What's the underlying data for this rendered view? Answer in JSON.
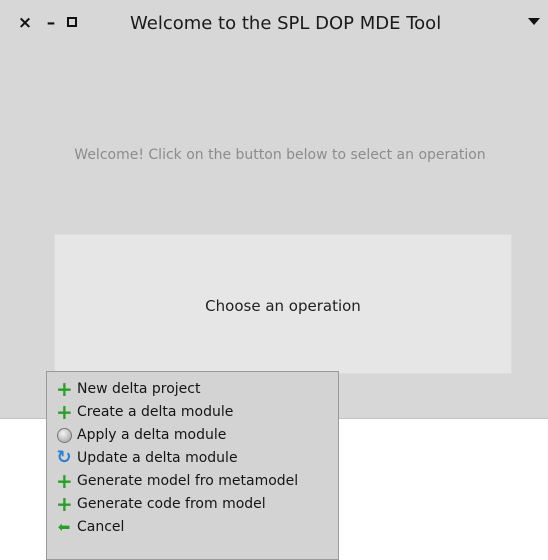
{
  "window": {
    "title": "Welcome to the SPL DOP MDE Tool",
    "close_glyph": "×",
    "minimize_glyph": "–",
    "menu_icon": "triangle-down"
  },
  "main": {
    "welcome_text": "Welcome! Click on the button below to select an operation",
    "choose_label": "Choose an operation"
  },
  "popup_menu": {
    "items": [
      {
        "label": "New delta project",
        "icon": "plus-icon"
      },
      {
        "label": "Create a delta module",
        "icon": "plus-icon"
      },
      {
        "label": "Apply a delta module",
        "icon": "apply-icon"
      },
      {
        "label": "Update a delta module",
        "icon": "refresh-icon"
      },
      {
        "label": "Generate model fro metamodel",
        "icon": "plus-icon"
      },
      {
        "label": "Generate code from model",
        "icon": "plus-icon"
      },
      {
        "label": "Cancel",
        "icon": "back-arrow-icon"
      }
    ]
  },
  "colors": {
    "plus": "#2a9d2a",
    "refresh": "#2f7fd0",
    "window_bg": "#d7d7d7"
  }
}
